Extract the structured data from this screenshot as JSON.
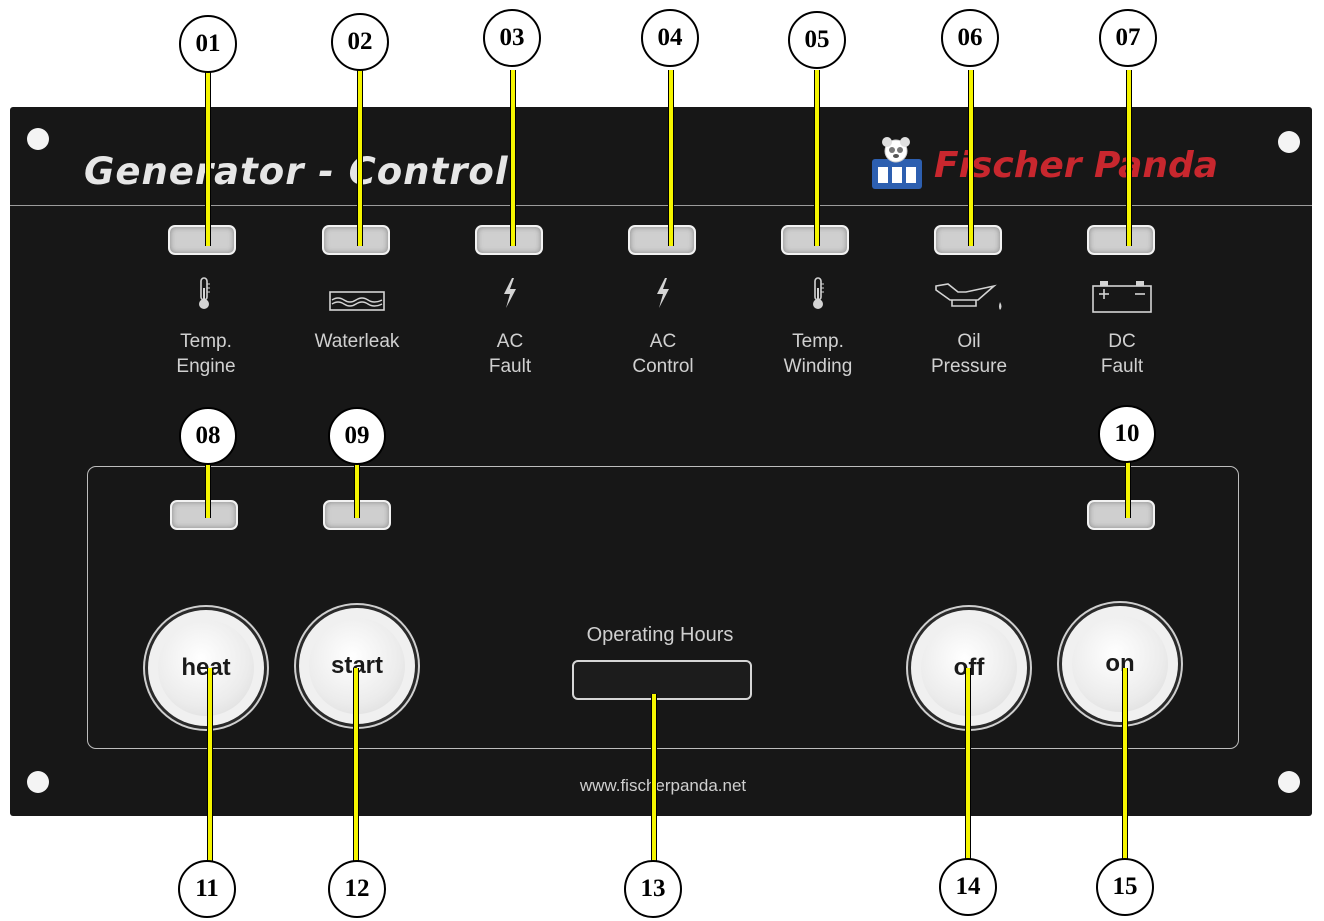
{
  "panel": {
    "title": "Generator - Control",
    "brand": "Fischer Panda",
    "website": "www.fischerpanda.net",
    "operating_hours_label": "Operating Hours"
  },
  "indicators": [
    {
      "line1": "Temp.",
      "line2": "Engine",
      "icon": "thermometer-icon"
    },
    {
      "line1": "Waterleak",
      "line2": "",
      "icon": "water-tank-icon"
    },
    {
      "line1": "AC",
      "line2": "Fault",
      "icon": "lightning-icon"
    },
    {
      "line1": "AC",
      "line2": "Control",
      "icon": "lightning-icon"
    },
    {
      "line1": "Temp.",
      "line2": "Winding",
      "icon": "thermometer-icon"
    },
    {
      "line1": "Oil",
      "line2": "Pressure",
      "icon": "oil-can-icon"
    },
    {
      "line1": "DC",
      "line2": "Fault",
      "icon": "battery-icon"
    }
  ],
  "buttons": {
    "heat": "heat",
    "start": "start",
    "off": "off",
    "on": "on"
  },
  "callouts": [
    "01",
    "02",
    "03",
    "04",
    "05",
    "06",
    "07",
    "08",
    "09",
    "10",
    "11",
    "12",
    "13",
    "14",
    "15"
  ],
  "colors": {
    "panel": "#171717",
    "brand": "#c8272e",
    "callout_line": "#f5f500"
  }
}
